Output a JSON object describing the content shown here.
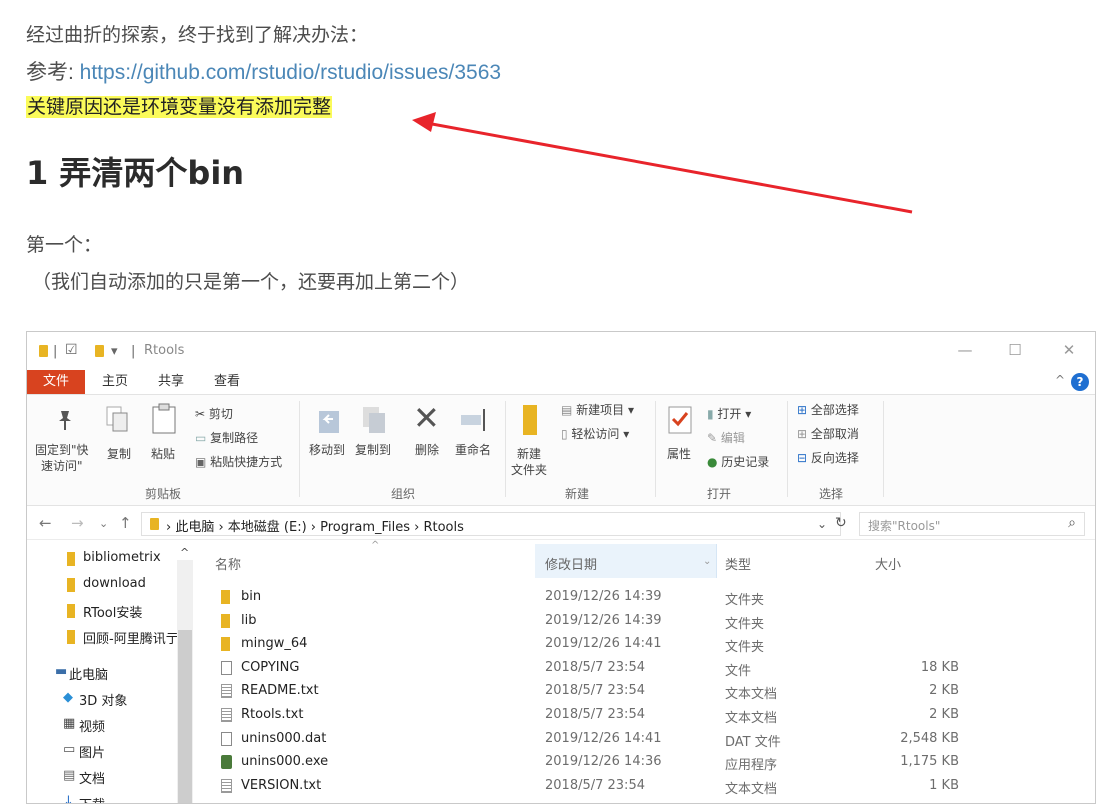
{
  "article": {
    "intro": "经过曲折的探索，终于找到了解决办法：",
    "ref_label": "参考: ",
    "ref_link": "https://github.com/rstudio/rstudio/issues/3563",
    "key_reason": "关键原因还是环境变量没有添加完整",
    "heading": "1 弄清两个bin",
    "first": "第一个：",
    "note": "（我们自动添加的只是第一个，还要再加上第二个）"
  },
  "window": {
    "title": "Rtools",
    "qat_sep": "|",
    "qat_dropdown": "▾",
    "controls": {
      "minimize": "—",
      "maximize": "☐",
      "close": "✕"
    },
    "tabs": [
      "文件",
      "主页",
      "共享",
      "查看"
    ],
    "help": "?",
    "collapse": "^",
    "ribbon": {
      "pin_label_1": "固定到\"快",
      "pin_label_2": "速访问\"",
      "copy": "复制",
      "paste": "粘贴",
      "cut": "剪切",
      "copy_path": "复制路径",
      "paste_shortcut": "粘贴快捷方式",
      "clipboard_group": "剪贴板",
      "move_to": "移动到",
      "copy_to": "复制到",
      "delete": "删除",
      "rename": "重命名",
      "organize_group": "组织",
      "new_item": "新建项目 ▾",
      "easy_access": "轻松访问 ▾",
      "new_folder_1": "新建",
      "new_folder_2": "文件夹",
      "new_group": "新建",
      "properties": "属性",
      "open": "打开 ▾",
      "edit": "编辑",
      "history": "历史记录",
      "open_group": "打开",
      "select_all": "全部选择",
      "select_none": "全部取消",
      "invert": "反向选择",
      "select_group": "选择"
    },
    "address": {
      "crumbs": "› 此电脑 › 本地磁盘 (E:) › Program_Files › Rtools",
      "search_placeholder": "搜索\"Rtools\""
    },
    "nav": {
      "items": [
        "bibliometrix",
        "download",
        "RTool安装",
        "回顾-阿里腾讯亍"
      ],
      "this_pc": "此电脑",
      "pc_items": [
        "3D 对象",
        "视频",
        "图片",
        "文档",
        "下载"
      ]
    },
    "columns": {
      "name": "名称",
      "date": "修改日期",
      "type": "类型",
      "size": "大小"
    },
    "files": [
      {
        "name": "bin",
        "date": "2019/12/26 14:39",
        "type": "文件夹",
        "size": "",
        "icon": "folder"
      },
      {
        "name": "lib",
        "date": "2019/12/26 14:39",
        "type": "文件夹",
        "size": "",
        "icon": "folder"
      },
      {
        "name": "mingw_64",
        "date": "2019/12/26 14:41",
        "type": "文件夹",
        "size": "",
        "icon": "folder"
      },
      {
        "name": "COPYING",
        "date": "2018/5/7 23:54",
        "type": "文件",
        "size": "18 KB",
        "icon": "file"
      },
      {
        "name": "README.txt",
        "date": "2018/5/7 23:54",
        "type": "文本文档",
        "size": "2 KB",
        "icon": "txt"
      },
      {
        "name": "Rtools.txt",
        "date": "2018/5/7 23:54",
        "type": "文本文档",
        "size": "2 KB",
        "icon": "txt"
      },
      {
        "name": "unins000.dat",
        "date": "2019/12/26 14:41",
        "type": "DAT 文件",
        "size": "2,548 KB",
        "icon": "dat"
      },
      {
        "name": "unins000.exe",
        "date": "2019/12/26 14:36",
        "type": "应用程序",
        "size": "1,175 KB",
        "icon": "exe"
      },
      {
        "name": "VERSION.txt",
        "date": "2018/5/7 23:54",
        "type": "文本文档",
        "size": "1 KB",
        "icon": "txt"
      }
    ]
  },
  "colors": {
    "link": "#4b87b7",
    "highlight": "#fbfb5a",
    "arrow": "#e8242b",
    "file_tab": "#d8431f"
  }
}
